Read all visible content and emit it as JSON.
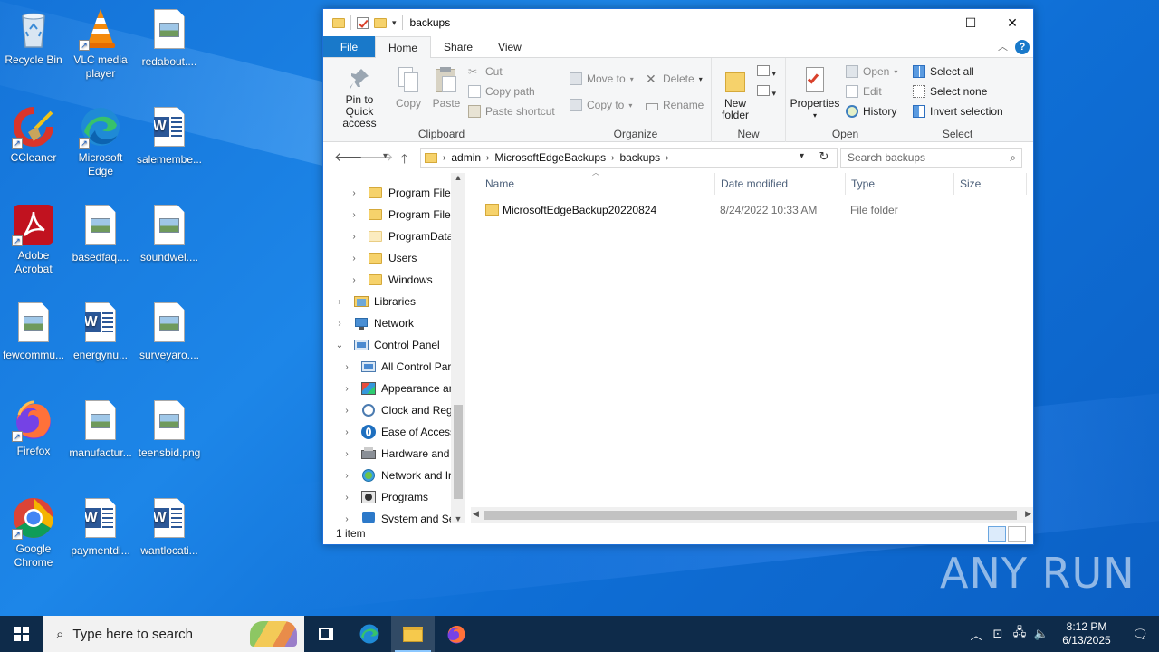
{
  "desktop": {
    "icons": [
      {
        "label": "Recycle Bin",
        "icon": "recycle-bin-icon"
      },
      {
        "label": "VLC media player",
        "icon": "vlc-icon"
      },
      {
        "label": "redabout....",
        "icon": "image-file-icon"
      },
      {
        "label": "CCleaner",
        "icon": "ccleaner-icon"
      },
      {
        "label": "Microsoft Edge",
        "icon": "edge-icon"
      },
      {
        "label": "salemembe...",
        "icon": "word-doc-icon"
      },
      {
        "label": "Adobe Acrobat",
        "icon": "acrobat-icon"
      },
      {
        "label": "basedfaq....",
        "icon": "image-file-icon"
      },
      {
        "label": "soundwel....",
        "icon": "image-file-icon"
      },
      {
        "label": "fewcommu...",
        "icon": "image-file-icon"
      },
      {
        "label": "energynu...",
        "icon": "word-doc-icon"
      },
      {
        "label": "surveyaro....",
        "icon": "image-file-icon"
      },
      {
        "label": "Firefox",
        "icon": "firefox-icon"
      },
      {
        "label": "manufactur...",
        "icon": "image-file-icon"
      },
      {
        "label": "teensbid.png",
        "icon": "image-file-icon"
      },
      {
        "label": "Google Chrome",
        "icon": "chrome-icon"
      },
      {
        "label": "paymentdi...",
        "icon": "word-doc-icon"
      },
      {
        "label": "wantlocati...",
        "icon": "word-doc-icon"
      }
    ]
  },
  "window": {
    "title": "backups",
    "tabs": {
      "file": "File",
      "home": "Home",
      "share": "Share",
      "view": "View"
    },
    "ribbon": {
      "clipboard": {
        "group": "Clipboard",
        "pin": "Pin to Quick access",
        "copy": "Copy",
        "paste": "Paste",
        "cut": "Cut",
        "copy_path": "Copy path",
        "paste_shortcut": "Paste shortcut"
      },
      "organize": {
        "group": "Organize",
        "move_to": "Move to",
        "copy_to": "Copy to",
        "delete": "Delete",
        "rename": "Rename"
      },
      "new": {
        "group": "New",
        "new_folder": "New folder"
      },
      "open": {
        "group": "Open",
        "properties": "Properties",
        "open": "Open",
        "edit": "Edit",
        "history": "History"
      },
      "select": {
        "group": "Select",
        "select_all": "Select all",
        "select_none": "Select none",
        "invert": "Invert selection"
      }
    },
    "address": {
      "crumbs": [
        "admin",
        "MicrosoftEdgeBackups",
        "backups"
      ],
      "search_placeholder": "Search backups"
    },
    "nav": [
      {
        "label": "Program Files",
        "icon": "folder-icon",
        "indent": 1
      },
      {
        "label": "Program Files",
        "icon": "folder-icon",
        "indent": 1
      },
      {
        "label": "ProgramData",
        "icon": "folder-icon",
        "indent": 1
      },
      {
        "label": "Users",
        "icon": "folder-icon",
        "indent": 1
      },
      {
        "label": "Windows",
        "icon": "folder-icon",
        "indent": 1
      },
      {
        "label": "Libraries",
        "icon": "libraries-icon",
        "indent": 0
      },
      {
        "label": "Network",
        "icon": "network-icon",
        "indent": 0
      },
      {
        "label": "Control Panel",
        "icon": "control-panel-icon",
        "indent": 0
      },
      {
        "label": "All Control Par",
        "icon": "control-panel-icon",
        "indent": 2
      },
      {
        "label": "Appearance an",
        "icon": "appearance-icon",
        "indent": 2
      },
      {
        "label": "Clock and Regi",
        "icon": "clock-icon",
        "indent": 2
      },
      {
        "label": "Ease of Access",
        "icon": "ease-of-access-icon",
        "indent": 2
      },
      {
        "label": "Hardware and",
        "icon": "hardware-icon",
        "indent": 2
      },
      {
        "label": "Network and Ir",
        "icon": "network-internet-icon",
        "indent": 2
      },
      {
        "label": "Programs",
        "icon": "programs-icon",
        "indent": 2
      },
      {
        "label": "System and Se",
        "icon": "shield-icon",
        "indent": 2
      }
    ],
    "columns": {
      "name": "Name",
      "date": "Date modified",
      "type": "Type",
      "size": "Size"
    },
    "files": [
      {
        "name": "MicrosoftEdgeBackup20220824",
        "date": "8/24/2022 10:33 AM",
        "type": "File folder",
        "size": ""
      }
    ],
    "status": "1 item"
  },
  "taskbar": {
    "search_placeholder": "Type here to search",
    "time": "8:12 PM",
    "date": "6/13/2025"
  },
  "watermark": "ANY RUN"
}
